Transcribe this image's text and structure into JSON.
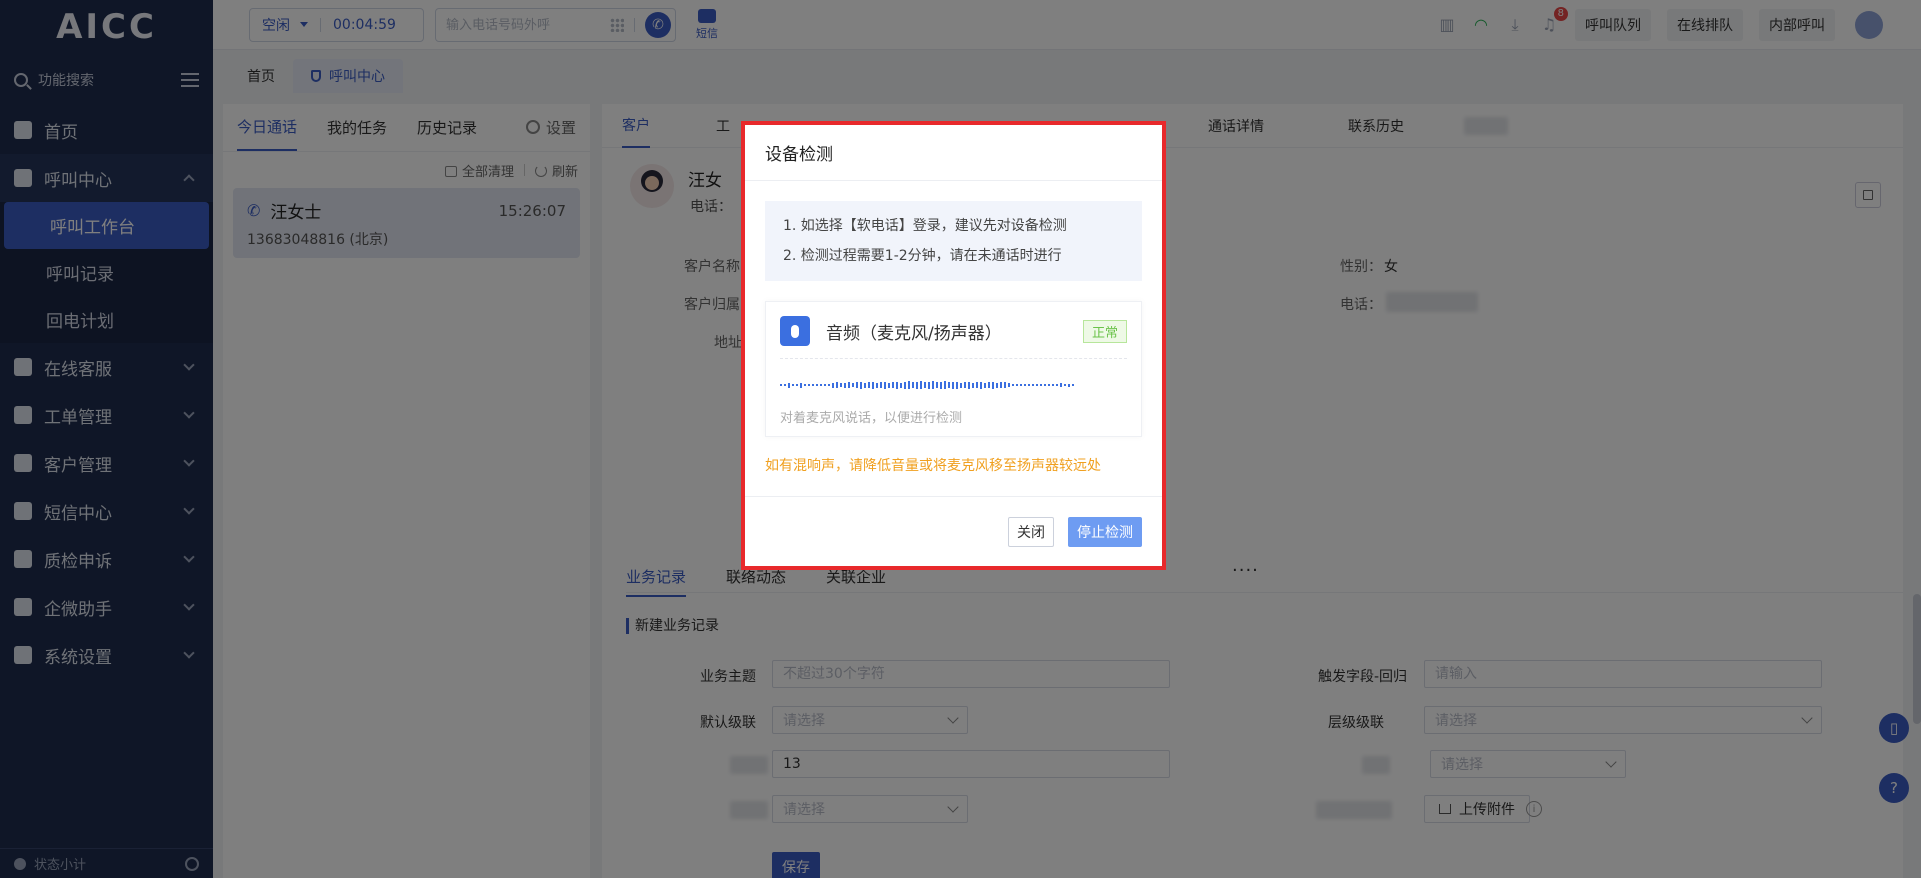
{
  "sidebar": {
    "logo": "AICC",
    "search_label": "功能搜索",
    "menu": [
      {
        "label": "首页"
      },
      {
        "label": "呼叫中心"
      },
      {
        "label": "在线客服"
      },
      {
        "label": "工单管理"
      },
      {
        "label": "客户管理"
      },
      {
        "label": "短信中心"
      },
      {
        "label": "质检申诉"
      },
      {
        "label": "企微助手"
      },
      {
        "label": "系统设置"
      }
    ],
    "submenu": [
      {
        "label": "呼叫工作台"
      },
      {
        "label": "呼叫记录"
      },
      {
        "label": "回电计划"
      }
    ],
    "footer_label": "状态小计"
  },
  "topbar": {
    "status": "空闲",
    "timer": "00:04:59",
    "dial_placeholder": "输入电话号码外呼",
    "sms_label": "短信",
    "notification_count": "8",
    "buttons": [
      "呼叫队列",
      "在线排队",
      "内部呼叫"
    ]
  },
  "page_tabs": [
    "首页",
    "呼叫中心"
  ],
  "left_panel": {
    "tabs": [
      "今日通话",
      "我的任务",
      "历史记录"
    ],
    "settings_label": "设置",
    "clear_all": "全部清理",
    "refresh": "刷新",
    "call": {
      "name": "汪女士",
      "time": "15:26:07",
      "phone": "13683048816 (北京)"
    }
  },
  "right_panel": {
    "tabs": [
      "客户",
      "工",
      "通话详情",
      "联系历史"
    ],
    "customer_name": "汪女",
    "phone_label": "电话：",
    "fields": {
      "name_label": "客户名称",
      "belong_label": "客户归属",
      "address_label": "地址",
      "gender_label": "性别：",
      "gender_value": "女",
      "phone2_label": "电话："
    },
    "more": "····",
    "biz_tabs": [
      "业务记录",
      "联络动态",
      "关联企业"
    ],
    "section_title": "新建业务记录",
    "form": {
      "subject_label": "业务主题",
      "subject_placeholder": "不超过30个字符",
      "trigger_label": "触发字段-回归",
      "trigger_placeholder": "请输入",
      "cascade_label": "默认级联",
      "cascade_placeholder": "请选择",
      "level_label": "层级级联",
      "level_placeholder": "请选择",
      "number_value": "13",
      "select3_placeholder": "请选择",
      "select4_placeholder": "请选择",
      "upload_label": "上传附件",
      "save_label": "保存"
    }
  },
  "modal": {
    "title": "设备检测",
    "tips": [
      "1. 如选择【软电话】登录，建议先对设备检测",
      "2. 检测过程需要1-2分钟，请在未通话时进行"
    ],
    "audio_title": "音频（麦克风/扬声器）",
    "audio_status": "正常",
    "audio_level": 0.5,
    "audio_hint": "对着麦克风说话，以便进行检测",
    "warning": "如有混响声，请降低音量或将麦克风移至扬声器较远处",
    "close_label": "关闭",
    "stop_label": "停止检测",
    "accent": "#e8292b"
  }
}
